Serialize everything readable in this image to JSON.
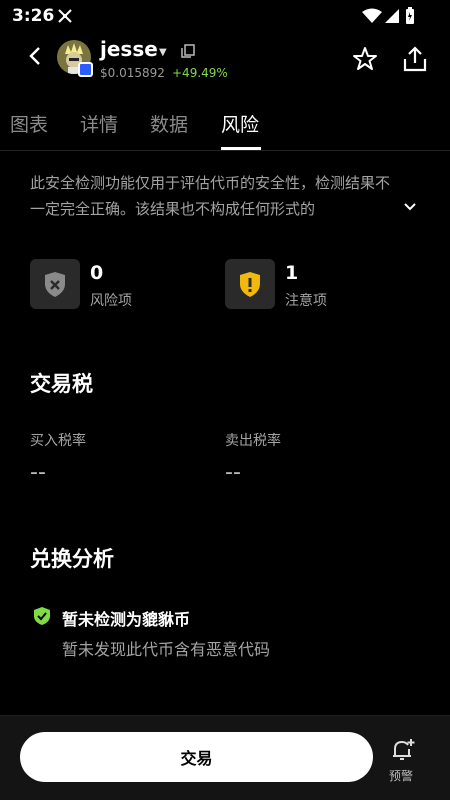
{
  "status_bar": {
    "time": "3:26"
  },
  "header": {
    "token_name": "jesse",
    "price": "$0.015892",
    "change": "+49.49%"
  },
  "tabs": [
    {
      "label": "图表"
    },
    {
      "label": "详情"
    },
    {
      "label": "数据"
    },
    {
      "label": "风险"
    }
  ],
  "notice": {
    "text": "此安全检测功能仅用于评估代币的安全性，检测结果不一定完全正确。该结果也不构成任何形式的"
  },
  "risk_stats": {
    "risk": {
      "count": "0",
      "label": "风险项"
    },
    "warning": {
      "count": "1",
      "label": "注意项"
    }
  },
  "tax": {
    "title": "交易税",
    "buy_label": "买入税率",
    "buy_value": "--",
    "sell_label": "卖出税率",
    "sell_value": "--"
  },
  "swap": {
    "title": "兑换分析",
    "check_title": "暂未检测为貔貅币",
    "check_desc": "暂未发现此代币含有恶意代码"
  },
  "bottom": {
    "trade_label": "交易",
    "alert_label": "预警"
  },
  "colors": {
    "accent_green": "#7fdc46",
    "warning": "#f0b90b"
  }
}
